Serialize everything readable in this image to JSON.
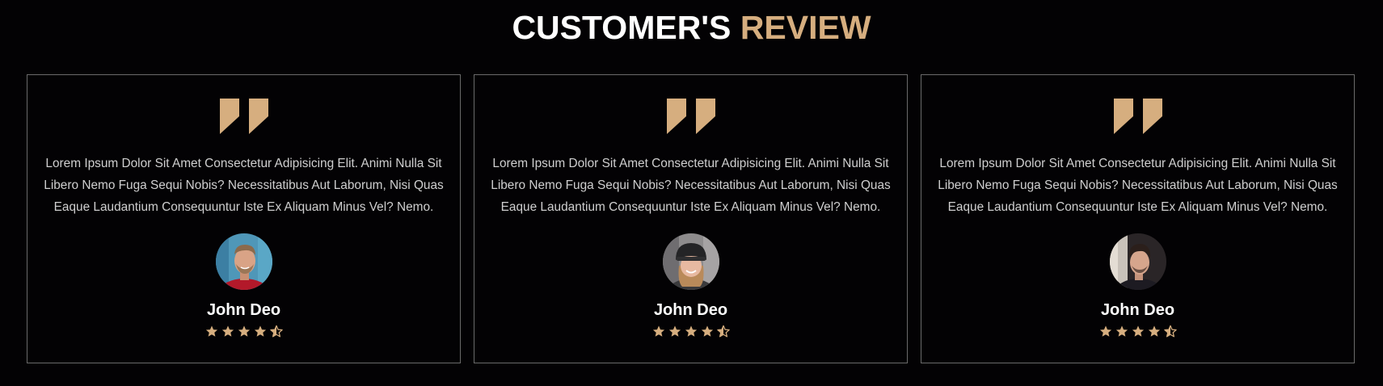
{
  "heading": {
    "word1": "CUSTOMER'S",
    "word2": "REVIEW"
  },
  "colors": {
    "background": "#030204",
    "accent": "#d6ae7f",
    "border": "#6a6a6a",
    "body_text": "#cfcfcf"
  },
  "reviews": [
    {
      "quote_icon": "quote-icon",
      "text": "Lorem Ipsum Dolor Sit Amet Consectetur Adipisicing Elit. Animi Nulla Sit Libero Nemo Fuga Sequi Nobis? Necessitatibus Aut Laborum, Nisi Quas Eaque Laudantium Consequuntur Iste Ex Aliquam Minus Vel? Nemo.",
      "avatar": "avatar-photo-man-smiling",
      "name": "John Deo",
      "rating": 4.5,
      "rating_max": 5
    },
    {
      "quote_icon": "quote-icon",
      "text": "Lorem Ipsum Dolor Sit Amet Consectetur Adipisicing Elit. Animi Nulla Sit Libero Nemo Fuga Sequi Nobis? Necessitatibus Aut Laborum, Nisi Quas Eaque Laudantium Consequuntur Iste Ex Aliquam Minus Vel? Nemo.",
      "avatar": "avatar-photo-woman-beanie",
      "name": "John Deo",
      "rating": 4.5,
      "rating_max": 5
    },
    {
      "quote_icon": "quote-icon",
      "text": "Lorem Ipsum Dolor Sit Amet Consectetur Adipisicing Elit. Animi Nulla Sit Libero Nemo Fuga Sequi Nobis? Necessitatibus Aut Laborum, Nisi Quas Eaque Laudantium Consequuntur Iste Ex Aliquam Minus Vel? Nemo.",
      "avatar": "avatar-photo-man-dark",
      "name": "John Deo",
      "rating": 4.5,
      "rating_max": 5
    }
  ]
}
